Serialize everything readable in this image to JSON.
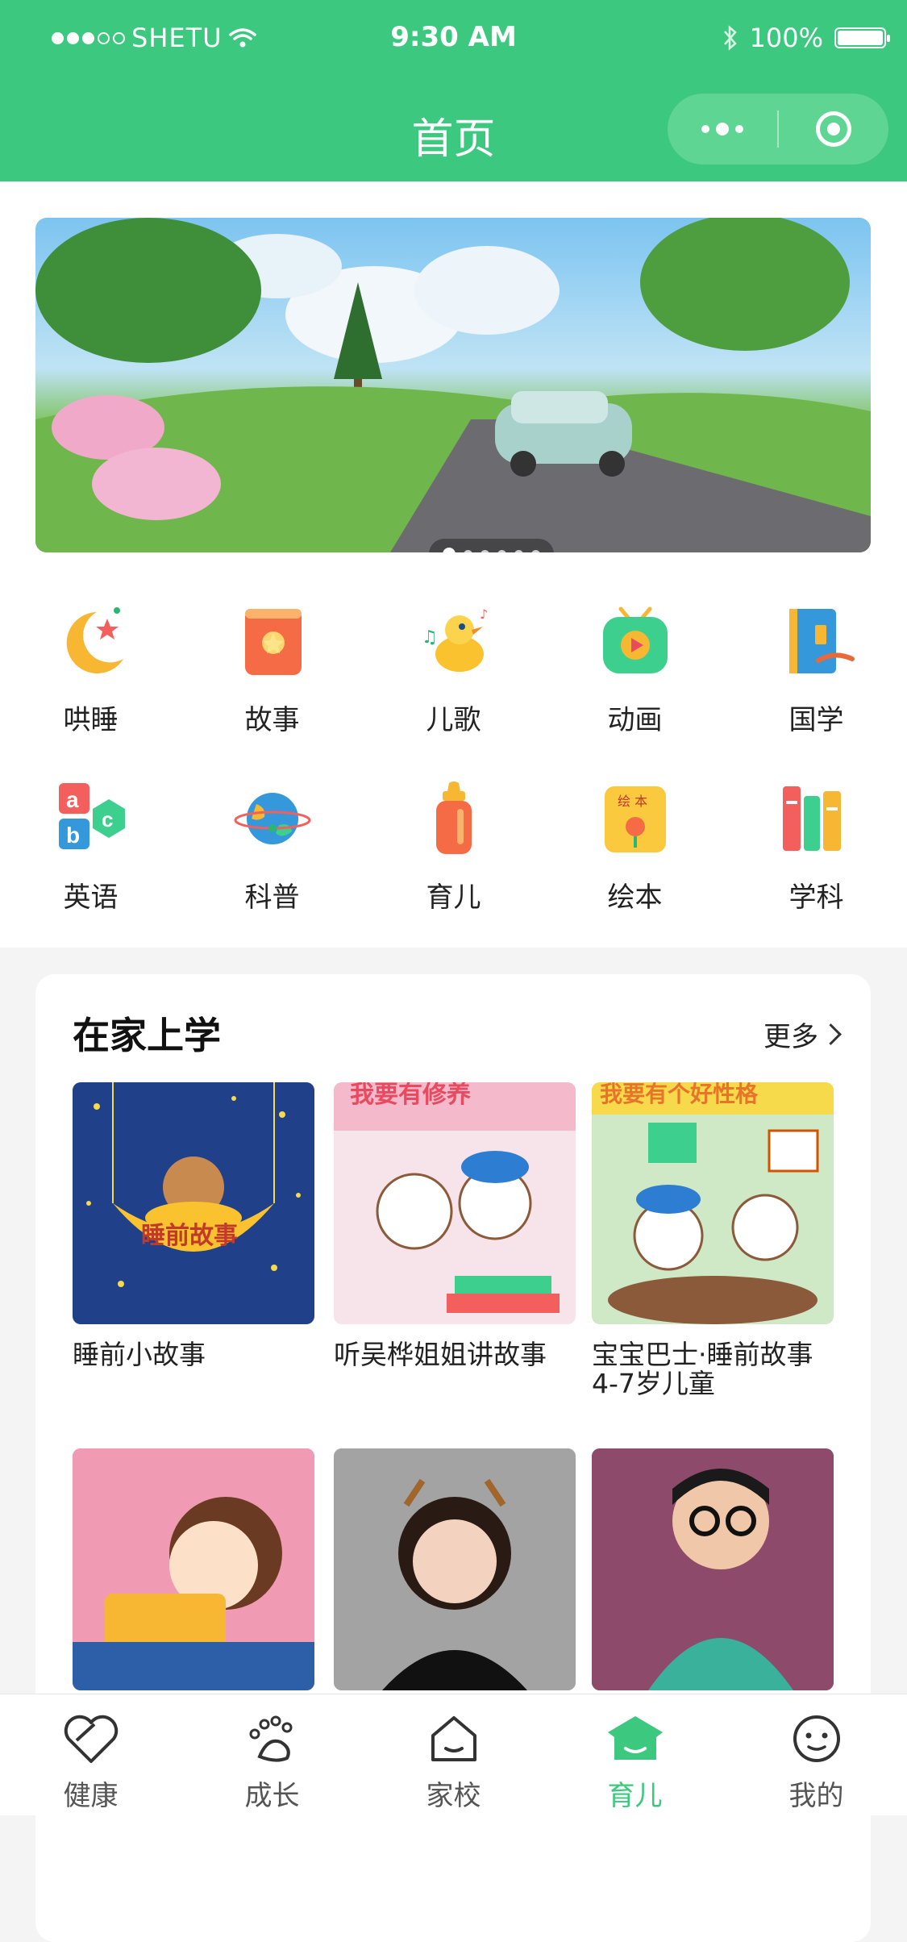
{
  "status_bar": {
    "carrier": "SHETU",
    "time": "9:30 AM",
    "battery": "100%"
  },
  "header": {
    "title": "首页"
  },
  "colors": {
    "brand": "#3cc87e",
    "active_tab": "#3cc87e"
  },
  "banner": {
    "slides": 6,
    "active_slide": 1
  },
  "categories": [
    {
      "label": "哄睡",
      "icon": "moon-icon"
    },
    {
      "label": "故事",
      "icon": "story-book-icon"
    },
    {
      "label": "儿歌",
      "icon": "duck-icon"
    },
    {
      "label": "动画",
      "icon": "tv-play-icon"
    },
    {
      "label": "国学",
      "icon": "classic-book-icon"
    },
    {
      "label": "英语",
      "icon": "abc-blocks-icon"
    },
    {
      "label": "科普",
      "icon": "planet-icon"
    },
    {
      "label": "育儿",
      "icon": "baby-bottle-icon"
    },
    {
      "label": "绘本",
      "icon": "picture-book-icon"
    },
    {
      "label": "学科",
      "icon": "books-icon"
    }
  ],
  "section": {
    "title": "在家上学",
    "more": "更多",
    "items": [
      {
        "label": "睡前小故事",
        "thumb_text": "睡前故事"
      },
      {
        "label": "听吴桦姐姐讲故事",
        "thumb_text": "我要有修养"
      },
      {
        "label": "宝宝巴士·睡前故事4-7岁儿童",
        "thumb_text": "我要有个好性格"
      },
      {
        "label": ""
      },
      {
        "label": ""
      },
      {
        "label": ""
      }
    ]
  },
  "tabbar": [
    {
      "label": "健康",
      "icon": "heart-icon"
    },
    {
      "label": "成长",
      "icon": "footprint-icon"
    },
    {
      "label": "家校",
      "icon": "house-icon"
    },
    {
      "label": "育儿",
      "icon": "house-filled-icon",
      "active": true
    },
    {
      "label": "我的",
      "icon": "smiley-icon"
    }
  ]
}
